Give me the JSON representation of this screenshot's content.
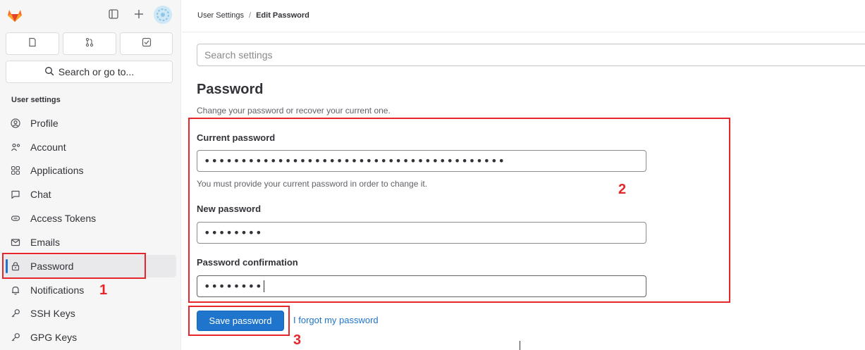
{
  "colors": {
    "accent": "#1f75cb",
    "annotation": "#e5262a",
    "sidebar_bg": "#f6f6f7"
  },
  "sidebar": {
    "search_label": "Search or go to...",
    "section_heading": "User settings",
    "items": [
      {
        "label": "Profile",
        "icon": "profile-icon"
      },
      {
        "label": "Account",
        "icon": "account-icon"
      },
      {
        "label": "Applications",
        "icon": "applications-icon"
      },
      {
        "label": "Chat",
        "icon": "chat-icon"
      },
      {
        "label": "Access Tokens",
        "icon": "token-icon"
      },
      {
        "label": "Emails",
        "icon": "mail-icon"
      },
      {
        "label": "Password",
        "icon": "lock-icon",
        "active": true
      },
      {
        "label": "Notifications",
        "icon": "bell-icon"
      },
      {
        "label": "SSH Keys",
        "icon": "key-icon"
      },
      {
        "label": "GPG Keys",
        "icon": "key-icon"
      }
    ]
  },
  "breadcrumb": {
    "parent": "User Settings",
    "separator": "/",
    "current": "Edit Password"
  },
  "search": {
    "placeholder": "Search settings"
  },
  "main": {
    "title": "Password",
    "description": "Change your password or recover your current one.",
    "current_password": {
      "label": "Current password",
      "value": "•••••••••••••••••••••••••••••••••••••••••",
      "help": "You must provide your current password in order to change it."
    },
    "new_password": {
      "label": "New password",
      "value": "••••••••"
    },
    "password_confirmation": {
      "label": "Password confirmation",
      "value": "••••••••"
    },
    "save_label": "Save password",
    "forgot_label": "I forgot my password"
  },
  "annotations": {
    "n1": "1",
    "n2": "2",
    "n3": "3"
  }
}
